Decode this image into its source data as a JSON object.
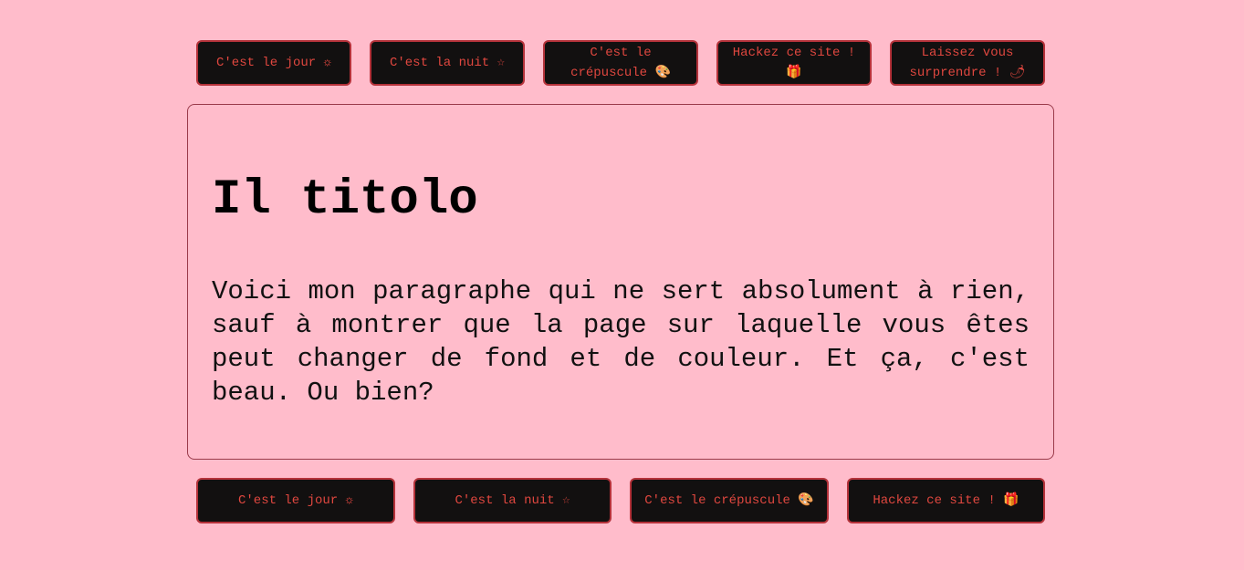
{
  "colors": {
    "background": "#ffbccb",
    "button_bg": "#121010",
    "button_text": "#e0473f",
    "button_border": "#b4323a"
  },
  "top_nav": {
    "buttons": [
      {
        "label": "C'est le jour ☼",
        "icon": "sun-icon"
      },
      {
        "label": "C'est la nuit ☆",
        "icon": "star-icon"
      },
      {
        "label": "C'est le crépuscule 🎨",
        "icon": "palette-icon"
      },
      {
        "label": "Hackez ce site ! 🎁",
        "icon": "gift-icon"
      },
      {
        "label": "Laissez vous surprendre ! 🌶",
        "icon": "pepper-icon"
      }
    ]
  },
  "main": {
    "title": "Il titolo",
    "paragraph": "Voici mon paragraphe qui ne sert absolument à rien, sauf à montrer que la page sur laquelle vous êtes peut changer de fond et de couleur. Et ça, c'est beau. Ou bien?"
  },
  "bottom_nav": {
    "buttons": [
      {
        "label": "C'est le jour ☼",
        "icon": "sun-icon"
      },
      {
        "label": "C'est la nuit ☆",
        "icon": "star-icon"
      },
      {
        "label": "C'est le crépuscule 🎨",
        "icon": "palette-icon"
      },
      {
        "label": "Hackez ce site ! 🎁",
        "icon": "gift-icon"
      }
    ]
  }
}
